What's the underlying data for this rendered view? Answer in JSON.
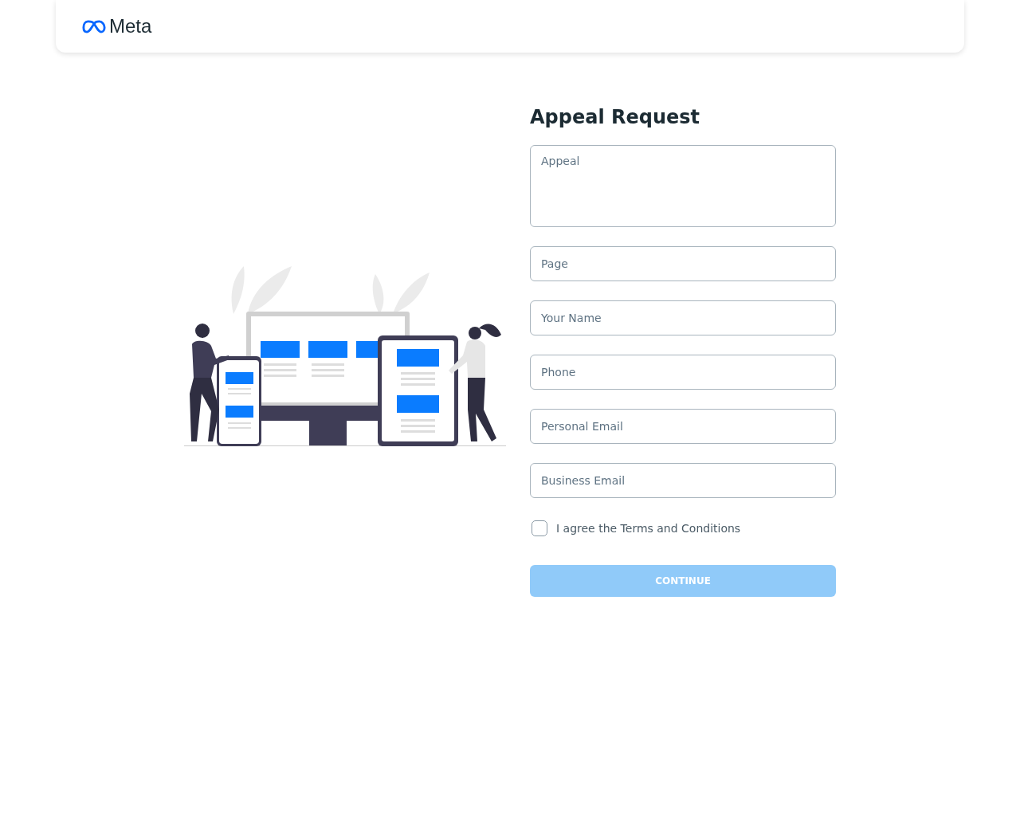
{
  "header": {
    "logo_text": "Meta"
  },
  "form": {
    "title": "Appeal Request",
    "fields": [
      {
        "kind": "textarea",
        "placeholder": "Appeal"
      },
      {
        "kind": "input",
        "placeholder": "Page"
      },
      {
        "kind": "input",
        "placeholder": "Your Name"
      },
      {
        "kind": "input",
        "placeholder": "Phone"
      },
      {
        "kind": "input",
        "placeholder": "Personal Email"
      },
      {
        "kind": "input",
        "placeholder": "Business Email"
      }
    ],
    "agree": {
      "label": "I agree the Terms and Conditions",
      "checked": false
    },
    "submit": {
      "label": "CONTINUE",
      "disabled": true
    }
  }
}
